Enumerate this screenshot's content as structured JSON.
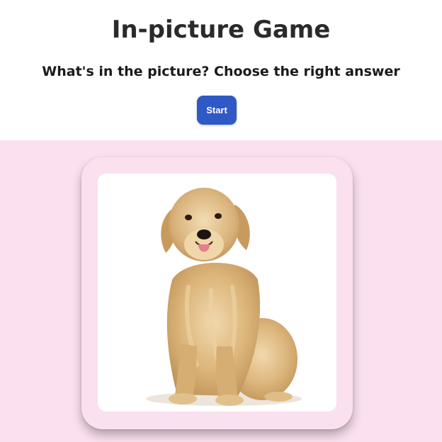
{
  "header": {
    "title": "In-picture Game",
    "subtitle": "What's in the picture? Choose the right answer",
    "start_label": "Start"
  },
  "card": {
    "picture": {
      "subject": "golden retriever dog sitting"
    }
  },
  "colors": {
    "stage_background": "#fbe0ef",
    "button": "#2f59c4",
    "title_text": "#2a2a2a"
  }
}
